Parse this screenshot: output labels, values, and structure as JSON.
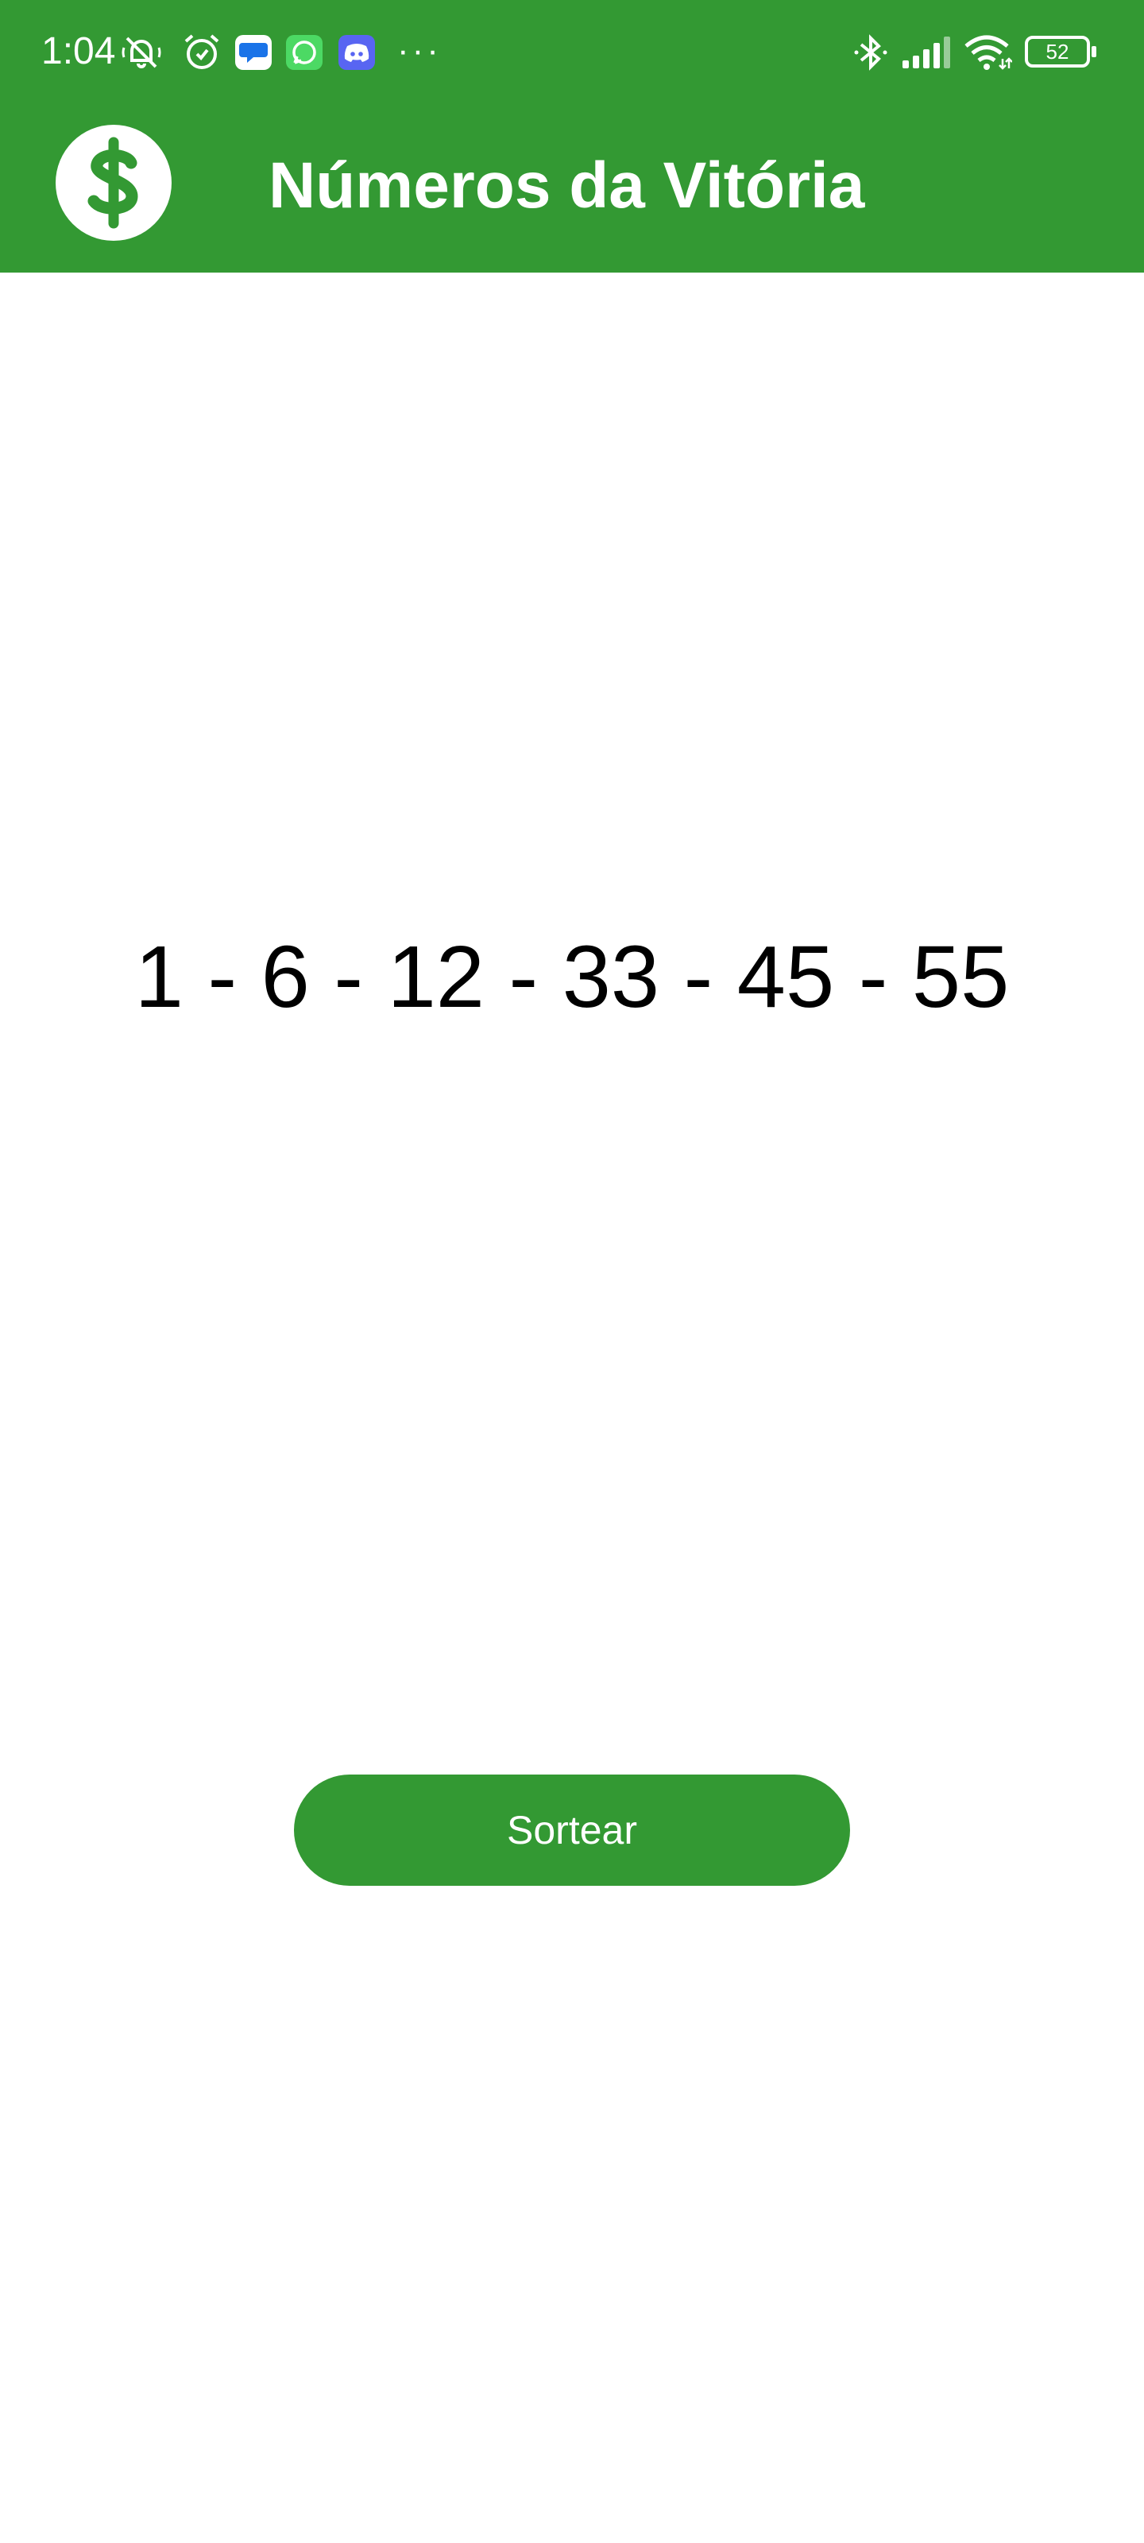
{
  "status_bar": {
    "time": "1:04",
    "left_icons": [
      "mute-notifications-icon",
      "alarm-icon",
      "messages-icon",
      "whatsapp-icon",
      "discord-icon"
    ],
    "more": "···",
    "right_icons": [
      "bluetooth-icon",
      "signal-icon",
      "wifi-icon",
      "battery-icon"
    ],
    "battery_level": "52"
  },
  "app_bar": {
    "logo_icon": "dollar-icon",
    "title": "Números da Vitória"
  },
  "main": {
    "numbers": "1 - 6 - 12 - 33 - 45 - 55",
    "draw_button_label": "Sortear"
  },
  "colors": {
    "primary": "#339933",
    "background": "#ffffff",
    "text": "#000000"
  }
}
